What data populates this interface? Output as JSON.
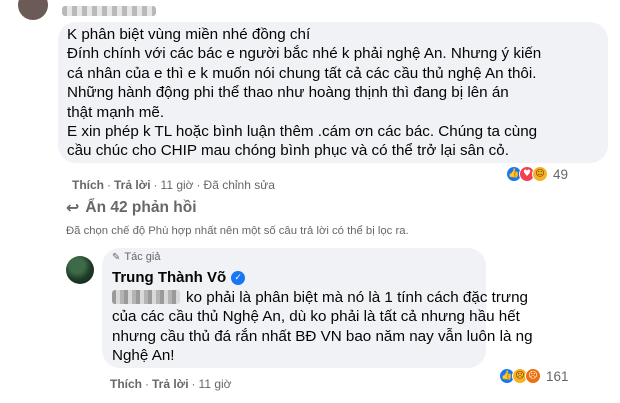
{
  "comment_1": {
    "lines": [
      "K phân biệt vùng miền nhé đồng chí",
      "Đính chính với các bác e người bắc nhé k phải nghệ An. Nhưng ý kiến",
      "cá nhân của e thì e k muốn nói chung tất cả các cầu thủ nghệ An thôi.",
      "Những hành động phi thể thao như hoàng thịnh thì đang bị lên án",
      "thật mạnh mẽ.",
      "E xin phép k TL hoặc bình luận thêm .cám ơn các bác. Chúng ta cùng",
      "cầu chúc cho CHIP mau chóng bình phục và có thể trở lại sân cỏ."
    ],
    "actions": {
      "like": "Thích",
      "reply": "Trả lời",
      "time": "11 giờ",
      "edited": "Đã chỉnh sửa"
    },
    "reactions": {
      "icons": [
        "like-icon",
        "love-icon",
        "haha-icon"
      ],
      "count": "49"
    }
  },
  "replies_toggle": {
    "label": "Ẩn 42 phản hồi",
    "icon": "reply-arrow-icon"
  },
  "filter_note": "Đã chọn chế độ Phù hợp nhất nên một số câu trả lời có thể bị lọc ra.",
  "comment_2": {
    "badge": "Tác giả",
    "author": "Trung Thành Võ",
    "lines": [
      "ko phải là phân biệt mà nó là 1 tính cách đặc trưng",
      "của các cầu thủ Nghệ An, dù ko phải là tất cả nhưng hầu hết",
      "nhưng cầu thủ đá rắn nhất BĐ VN bao năm nay vẫn luôn là ng",
      "Nghệ An!"
    ],
    "actions": {
      "like": "Thích",
      "reply": "Trả lời",
      "time": "11 giờ"
    },
    "reactions": {
      "icons": [
        "like-icon",
        "sad-icon",
        "angry-icon"
      ],
      "count": "161"
    }
  },
  "colors": {
    "bubble": "#f0f2f5",
    "meta_text": "#65676b",
    "like_blue": "#1877f2"
  }
}
